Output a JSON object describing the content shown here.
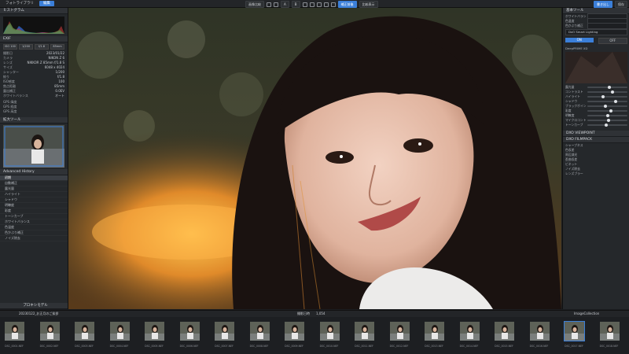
{
  "topbar": {
    "tabs": [
      "フォトライブラリ",
      "編集"
    ],
    "active_tab": "編集",
    "center_buttons": [
      "画像比較",
      "A",
      "B",
      "補正前後",
      "比較表示"
    ],
    "right_buttons": [
      "書き出し",
      "保存"
    ]
  },
  "left_panel": {
    "histogram_title": "ヒストグラム",
    "exif_title": "EXIF",
    "exif_chips": [
      "ISO 100",
      "1/200",
      "f/1.8",
      "85mm"
    ],
    "exif_rows": [
      {
        "k": "撮影日",
        "v": "2023/01/22"
      },
      {
        "k": "カメラ",
        "v": "NIKON Z 6"
      },
      {
        "k": "レンズ",
        "v": "NIKKOR Z 85mm f/1.8 S"
      },
      {
        "k": "サイズ",
        "v": "6048 x 4024"
      },
      {
        "k": "シャッター",
        "v": "1/200"
      },
      {
        "k": "絞り",
        "v": "f/1.8"
      },
      {
        "k": "ISO感度",
        "v": "100"
      },
      {
        "k": "焦点距離",
        "v": "85mm"
      },
      {
        "k": "露出補正",
        "v": "0.0EV"
      },
      {
        "k": "ホワイトバランス",
        "v": "オート"
      }
    ],
    "gps_rows": [
      "GPS 緯度",
      "GPS 経度",
      "GPS 高度"
    ],
    "navigator_title": "拡大ツール",
    "history_title": "Advanced History",
    "history_rows": [
      "初期",
      "自動補正",
      "露光量",
      "ハイライト",
      "シャドウ",
      "明瞭度",
      "彩度",
      "トーンカーブ",
      "ホワイトバランス",
      "色温度",
      "色かぶり補正",
      "ノイズ除去"
    ],
    "history_footer": "プロキシモデル"
  },
  "right_panel": {
    "title": "基本ツール",
    "rows_a": [
      "ホワイトバランス",
      "色温度",
      "色かぶり補正"
    ],
    "preset_label": "DxO Smart Lighting",
    "mode_buttons": [
      "ON",
      "OFF"
    ],
    "preview_label": "DeepPRIME XD",
    "sliders": [
      {
        "label": "露光量",
        "pos": 55
      },
      {
        "label": "コントラスト",
        "pos": 62
      },
      {
        "label": "ハイライト",
        "pos": 40
      },
      {
        "label": "シャドウ",
        "pos": 70
      },
      {
        "label": "ブラックポイント",
        "pos": 45
      },
      {
        "label": "彩度",
        "pos": 58
      },
      {
        "label": "明瞭度",
        "pos": 50
      },
      {
        "label": "マイクロコントラスト",
        "pos": 52
      },
      {
        "label": "トーンカーブ",
        "pos": 48
      }
    ],
    "section2": "DXO VIEWPOINT",
    "section3": "DXO FILMPACK",
    "bottom_rows": [
      "シャープネス",
      "色収差",
      "周辺減光",
      "歪曲収差",
      "ビネット",
      "ノイズ除去",
      "レンズブラー"
    ]
  },
  "bottombar": {
    "folder": "20230122_お正月のご挨拶",
    "count": "1,054",
    "sort": "撮影日時",
    "right_label": "ImageCollection"
  },
  "filmstrip": [
    "DSC_0001.NEF",
    "DSC_0002.NEF",
    "DSC_0003.NEF",
    "DSC_0004.NEF",
    "DSC_0005.NEF",
    "DSC_0006.NEF",
    "DSC_0007.NEF",
    "DSC_0008.NEF",
    "DSC_0009.NEF",
    "DSC_0010.NEF",
    "DSC_0011.NEF",
    "DSC_0012.NEF",
    "DSC_0013.NEF",
    "DSC_0014.NEF",
    "DSC_0015.NEF",
    "DSC_0016.NEF",
    "DSC_0017.NEF",
    "DSC_0018.NEF"
  ]
}
